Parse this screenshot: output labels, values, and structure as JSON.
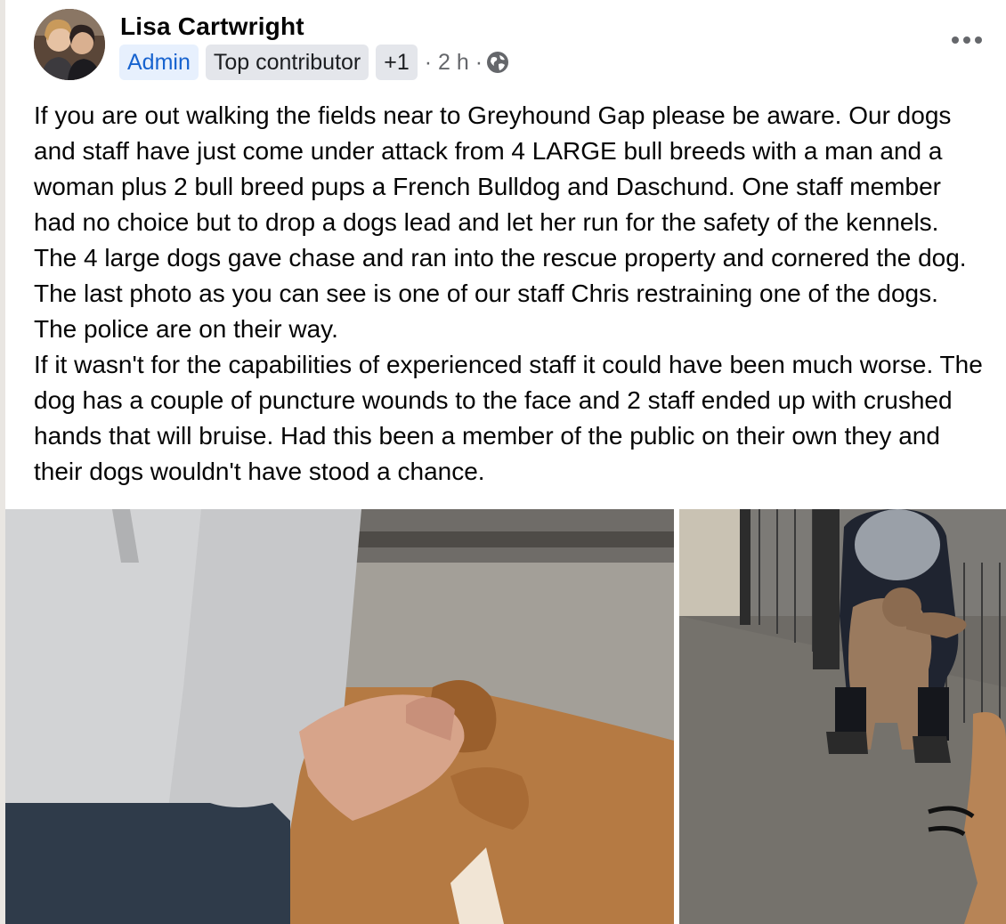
{
  "post": {
    "author": "Lisa Cartwright",
    "badges": {
      "admin": "Admin",
      "top_contributor": "Top contributor",
      "more": "+1"
    },
    "timestamp": "· 2 h ·",
    "audience_icon": "globe-icon",
    "more_options_icon": "more-options-icon",
    "body": "If you are out walking the fields near to Greyhound Gap please be aware. Our dogs and staff have just come under attack from 4 LARGE bull breeds with a man and a woman plus 2 bull breed pups a French Bulldog and Daschund. One staff member had no choice but to drop a dogs lead and let her run for the safety of the kennels. The 4 large dogs gave chase and ran into the rescue property and cornered the dog. The last photo as you can see is one of our staff Chris restraining one of the dogs. The police are on their way.\nIf it wasn't for the capabilities of experienced staff it could have been much worse. The dog has a couple of puncture wounds to the face and 2 staff ended up with crushed hands that will bruise. Had this been a member of the public on their own they and their dogs wouldn't have stood a chance.",
    "photos": [
      {
        "description_icon": "photo-hand-on-dog"
      },
      {
        "description_icon": "photo-staff-restraining-dog"
      }
    ]
  },
  "colors": {
    "admin_badge_bg": "#e7f0fd",
    "admin_badge_text": "#1763cf",
    "badge_bg": "#e4e6eb",
    "meta_text": "#65676b"
  }
}
